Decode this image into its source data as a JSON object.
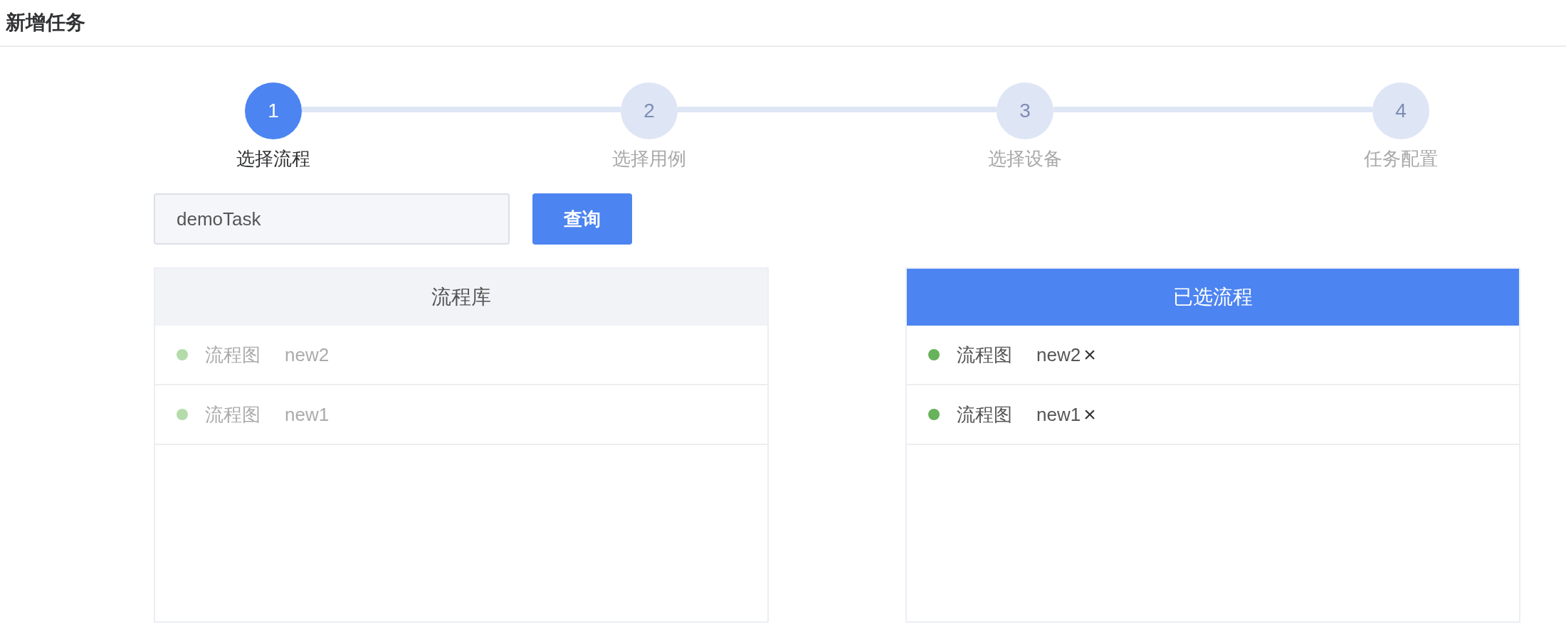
{
  "page": {
    "title": "新增任务"
  },
  "steps": [
    {
      "number": "1",
      "label": "选择流程",
      "active": true
    },
    {
      "number": "2",
      "label": "选择用例",
      "active": false
    },
    {
      "number": "3",
      "label": "选择设备",
      "active": false
    },
    {
      "number": "4",
      "label": "任务配置",
      "active": false
    }
  ],
  "search": {
    "value": "demoTask",
    "button": "查询"
  },
  "library": {
    "title": "流程库",
    "selected": false,
    "items": [
      {
        "type": "流程图",
        "name": "new2",
        "disabled": true,
        "color": "#b3dcaa"
      },
      {
        "type": "流程图",
        "name": "new1",
        "disabled": true,
        "color": "#b3dcaa"
      }
    ]
  },
  "chosen": {
    "title": "已选流程",
    "selected": true,
    "items": [
      {
        "type": "流程图",
        "name": "new2",
        "remove": "×",
        "disabled": false,
        "color": "#67b25a"
      },
      {
        "type": "流程图",
        "name": "new1",
        "remove": "×",
        "disabled": false,
        "color": "#67b25a"
      }
    ]
  }
}
